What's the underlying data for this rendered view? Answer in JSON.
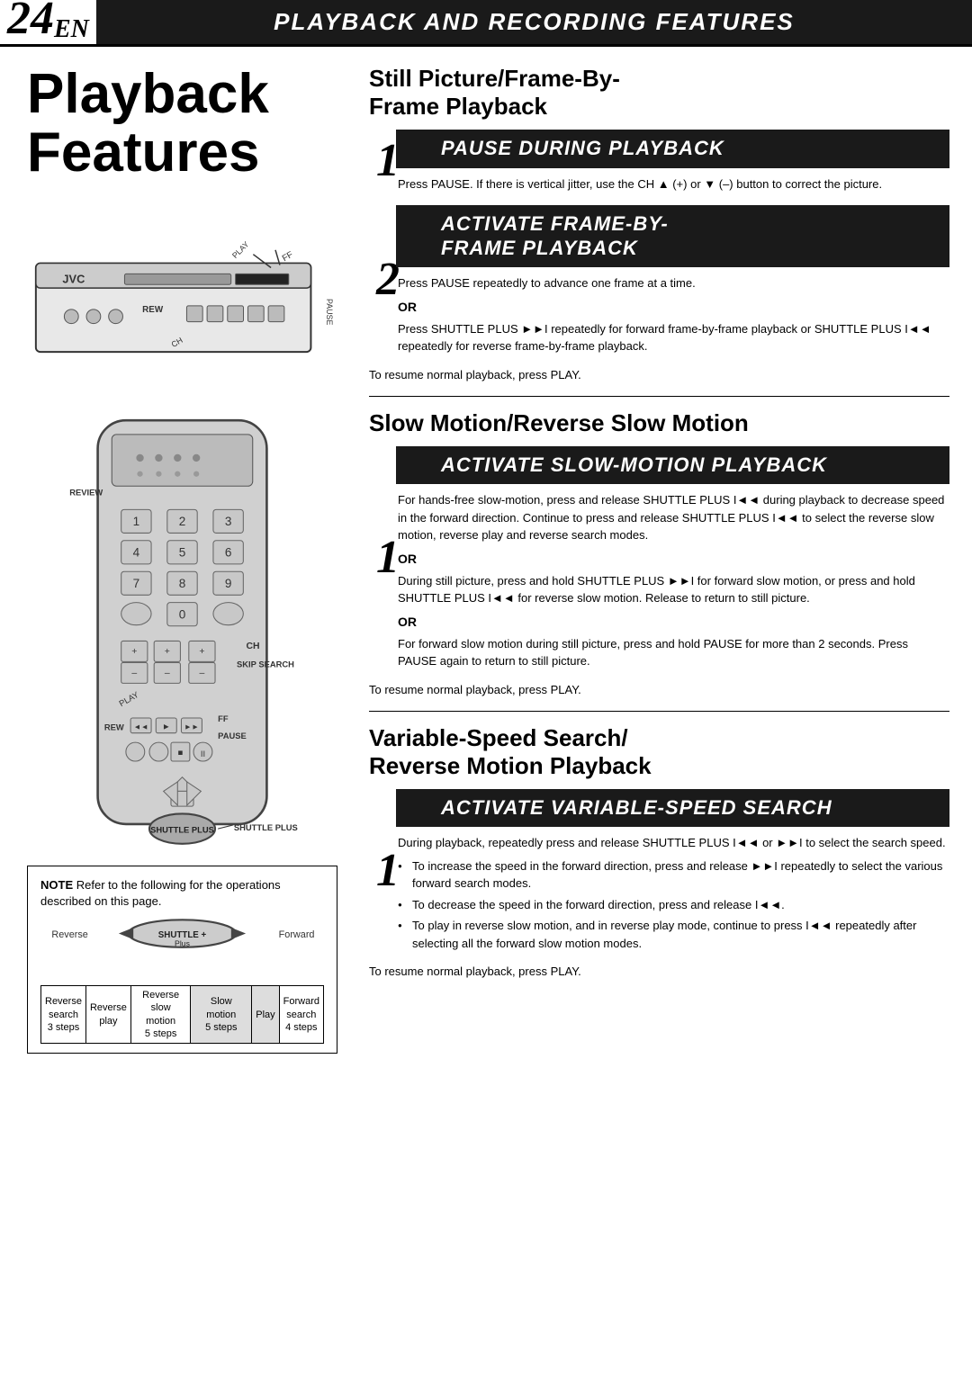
{
  "header": {
    "page_number": "24",
    "page_suffix": "EN",
    "title": "PLAYBACK AND RECORDING FEATURES"
  },
  "left": {
    "heading": "Playback Features",
    "note": {
      "label": "NOTE",
      "text": "Refer to the following for the operations described on this page."
    },
    "shuttle_diagram": {
      "reverse_label": "Reverse",
      "forward_label": "Forward",
      "shuttle_plus_label": "SHUTTLE PLUS",
      "columns": [
        {
          "header": "Reverse search",
          "sub": "3 steps"
        },
        {
          "header": "Reverse play",
          "sub": ""
        },
        {
          "header": "Reverse slow motion",
          "sub": "5 steps"
        },
        {
          "header": "Slow motion",
          "sub": "5 steps"
        },
        {
          "header": "Play",
          "sub": ""
        },
        {
          "header": "Forward search",
          "sub": "4 steps"
        }
      ]
    }
  },
  "right": {
    "section1": {
      "heading": "Still Picture/Frame-By-\nFrame Playback",
      "step1": {
        "box_title": "PAUSE DURING PLAYBACK",
        "content": "Press PAUSE. If there is vertical jitter, use the CH ▲ (+) or ▼ (–) button to correct the picture."
      },
      "step2": {
        "box_title": "ACTIVATE FRAME-BY-\nFRAME PLAYBACK",
        "content_main": "Press PAUSE repeatedly to advance one frame at a time.",
        "or": "OR",
        "content_alt": "Press SHUTTLE PLUS ►►I repeatedly for forward frame-by-frame playback or SHUTTLE PLUS I◄◄ repeatedly for reverse frame-by-frame playback."
      },
      "resume": "To resume normal playback, press PLAY."
    },
    "section2": {
      "heading": "Slow Motion/Reverse Slow Motion",
      "step1": {
        "box_title": "ACTIVATE SLOW-MOTION PLAYBACK",
        "content_main": "For hands-free slow-motion, press and release SHUTTLE PLUS I◄◄ during playback to decrease speed in the forward direction. Continue to press and release SHUTTLE PLUS I◄◄ to select the reverse slow motion, reverse play and reverse search modes.",
        "or1": "OR",
        "content_or1": "During still picture, press and hold SHUTTLE PLUS ►►I for forward slow motion, or press and hold SHUTTLE PLUS I◄◄ for reverse slow motion. Release to return to still picture.",
        "or2": "OR",
        "content_or2": "For forward slow motion during still picture, press and hold PAUSE for more than 2 seconds. Press PAUSE again to return to still picture."
      },
      "resume": "To resume normal playback, press PLAY."
    },
    "section3": {
      "heading": "Variable-Speed Search/\nReverse Motion Playback",
      "step1": {
        "box_title": "ACTIVATE VARIABLE-SPEED SEARCH",
        "content_main": "During playback, repeatedly press and release SHUTTLE PLUS I◄◄ or ►►I to select the search speed.",
        "bullets": [
          "To increase the speed in the forward direction, press and release ►►I repeatedly to select the various forward search modes.",
          "To decrease the speed in the forward direction, press and release I◄◄.",
          "To play in reverse slow motion, and in reverse play mode, continue to press I◄◄ repeatedly after selecting all the forward slow motion modes."
        ]
      },
      "resume": "To resume normal playback, press PLAY."
    }
  }
}
